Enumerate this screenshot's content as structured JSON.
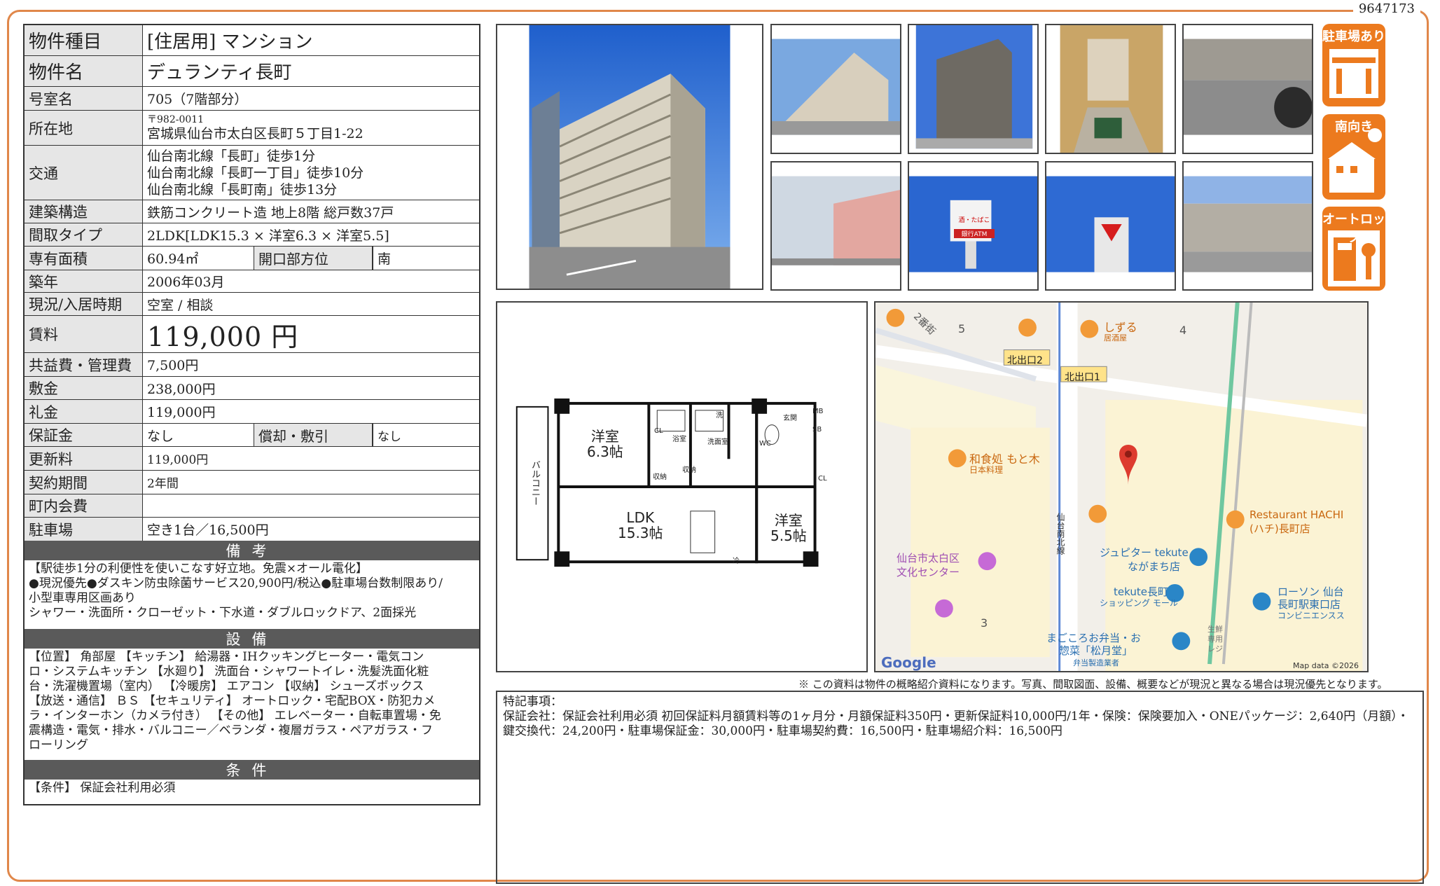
{
  "doc_id": "9647173",
  "property": {
    "type_label": "物件種目",
    "type_value": "[住居用] マンション",
    "name_label": "物件名",
    "name_value": "デュランティ長町",
    "room_label": "号室名",
    "room_value": "705（7階部分）",
    "address_label": "所在地",
    "postal": "〒982-0011",
    "address": "宮城県仙台市太白区長町５丁目1-22",
    "transit_label": "交通",
    "transit": [
      "仙台南北線「長町」徒歩1分",
      "仙台南北線「長町一丁目」徒歩10分",
      "仙台南北線「長町南」徒歩13分"
    ],
    "structure_label": "建築構造",
    "structure_value": "鉄筋コンクリート造 地上8階 総戸数37戸",
    "layout_label": "間取タイプ",
    "layout_value": "2LDK[LDK15.3 × 洋室6.3 × 洋室5.5]",
    "area_label": "専有面積",
    "area_value": "60.94㎡",
    "direction_label": "開口部方位",
    "direction_value": "南",
    "built_label": "築年",
    "built_value": "2006年03月",
    "status_label": "現況/入居時期",
    "status_value": "空室 / 相談",
    "rent_label": "賃料",
    "rent_value": "119,000 円",
    "fee_label": "共益費・管理費",
    "fee_value": "7,500円",
    "deposit_label": "敷金",
    "deposit_value": "238,000円",
    "key_label": "礼金",
    "key_value": "119,000円",
    "guarantee_label": "保証金",
    "guarantee_value": "なし",
    "amort_label": "償却・敷引",
    "amort_value": "なし",
    "renewal_label": "更新料",
    "renewal_value": "119,000円",
    "term_label": "契約期間",
    "term_value": "2年間",
    "town_label": "町内会費",
    "town_value": "",
    "parking_label": "駐車場",
    "parking_value": "空き1台／16,500円"
  },
  "remarks": {
    "title": "備考",
    "lines": [
      "【駅徒歩1分の利便性を使いこなす好立地。免震×オール電化】",
      "●現況優先●ダスキン防虫除菌サービス20,900円/税込●駐車場台数制限あり/",
      "小型車専用区画あり",
      "シャワー・洗面所・クローゼット・下水道・ダブルロックドア、2面採光"
    ]
  },
  "equipment": {
    "title": "設備",
    "lines": [
      "【位置】 角部屋 【キッチン】 給湯器・IHクッキングヒーター・電気コン",
      "ロ・システムキッチン 【水廻り】 洗面台・シャワートイレ・洗髪洗面化粧",
      "台・洗濯機置場（室内） 【冷暖房】 エアコン 【収納】 シューズボックス",
      "【放送・通信】 ＢＳ 【セキュリティ】 オートロック・宅配BOX・防犯カメ",
      "ラ・インターホン（カメラ付き） 【その他】 エレベーター・自転車置場・免",
      "震構造・電気・排水・バルコニー／ベランダ・複層ガラス・ペアガラス・フ",
      "ローリング"
    ]
  },
  "conditions": {
    "title": "条件",
    "text": "【条件】 保証会社利用必須"
  },
  "badges": [
    {
      "label": "駐車場あり",
      "icon": "parking-icon"
    },
    {
      "label": "南向き",
      "icon": "south-facing-icon"
    },
    {
      "label": "オートロック",
      "icon": "autolock-icon"
    }
  ],
  "floorplan": {
    "rooms": [
      {
        "name": "洋室",
        "size": "6.3帖"
      },
      {
        "name": "LDK",
        "size": "15.3帖"
      },
      {
        "name": "洋室",
        "size": "5.5帖"
      }
    ],
    "small_labels": [
      "CL",
      "浴室",
      "洗",
      "洗面室",
      "WC",
      "玄関",
      "MB",
      "SB",
      "収納",
      "収納",
      "CL",
      "冷",
      "バルコニー"
    ]
  },
  "map": {
    "labels": [
      "2番街",
      "5",
      "4",
      "しずる",
      "居酒屋",
      "北出口2",
      "北出口1",
      "和食処 もと木",
      "日本料理",
      "Restaurant HACHI",
      "(ハチ)長町店",
      "仙台市太白区",
      "文化センター",
      "ジュピター tekute",
      "ながまち店",
      "tekute長町",
      "ショッピング モール",
      "ローソン 仙台",
      "長町駅東口店",
      "コンビニエンスス",
      "3",
      "まごころお弁当・お",
      "惣菜「松月堂」",
      "弁当製造業者",
      "生鮮",
      "専用",
      "レジ",
      "仙台南北線",
      "Google",
      "Map data ©2026"
    ]
  },
  "notice": "※ この資料は物件の概略紹介資料になります。写真、間取図面、設備、概要などが現況と異なる場合は現況優先となります。",
  "special": {
    "title": "特記事項：",
    "text": "保証会社：保証会社利用必須 初回保証料月額賃料等の1ヶ月分・月額保証料350円・更新保証料10,000円/1年・保険：保険要加入・ONEパッケージ：2,640円（月額）・鍵交換代：24,200円・駐車場保証金：30,000円・駐車場契約費：16,500円・駐車場紹介料：16,500円"
  },
  "photo_signs": [
    "酒・たばこ",
    "銀行ATM"
  ],
  "colors": {
    "accent": "#ec7a1e",
    "frame": "#e0874a",
    "header_gray": "#5a5a5a",
    "label_gray": "#e6e6e6",
    "sky": "#2f6fd6"
  }
}
